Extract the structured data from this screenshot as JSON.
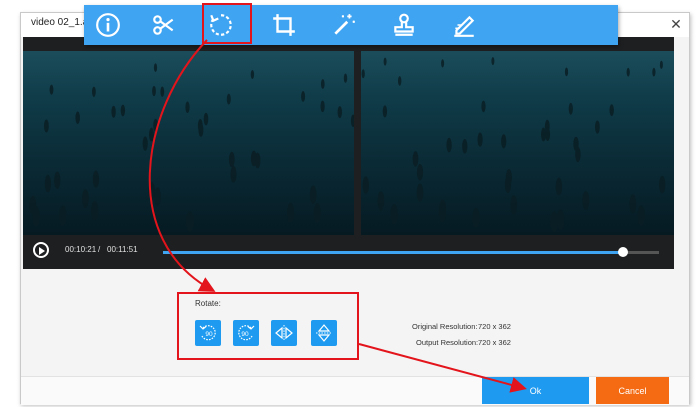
{
  "window": {
    "title": "video 02_1.avi",
    "close_glyph": "✕"
  },
  "toolbar": {
    "items": [
      {
        "name": "info-icon"
      },
      {
        "name": "scissors-icon"
      },
      {
        "name": "rotate-icon",
        "active": true
      },
      {
        "name": "crop-icon"
      },
      {
        "name": "magic-wand-icon"
      },
      {
        "name": "stamp-icon"
      },
      {
        "name": "pen-icon"
      }
    ],
    "color": "#3fa4f2"
  },
  "player": {
    "current_time": "00:10:21",
    "separator": "/",
    "total_time": "00:11:51",
    "progress": 0.927
  },
  "rotate": {
    "label": "Rotate:",
    "buttons": [
      {
        "name": "rotate-left-90-icon",
        "text": "90"
      },
      {
        "name": "rotate-right-90-icon",
        "text": "90"
      },
      {
        "name": "flip-horizontal-icon"
      },
      {
        "name": "flip-vertical-icon"
      }
    ]
  },
  "resolution": {
    "original_label": "Original Resolution:",
    "original_value": "720 x 362",
    "output_label": "Output Resolution:",
    "output_value": "720 x 362"
  },
  "actions": {
    "ok_label": "Ok",
    "cancel_label": "Cancel"
  },
  "colors": {
    "accent": "#1e9bf0",
    "cancel": "#f46b13",
    "annotation": "#e3141b"
  }
}
